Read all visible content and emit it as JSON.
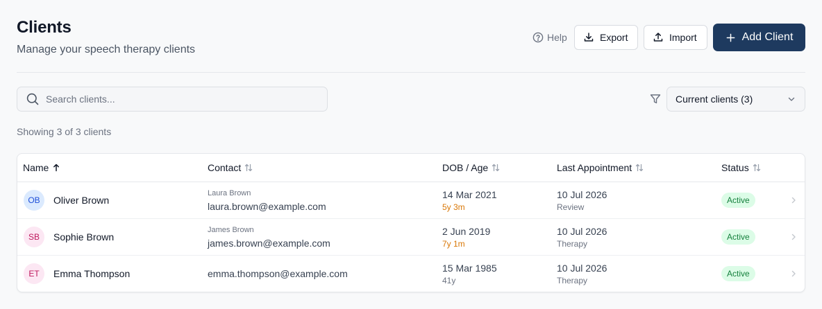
{
  "header": {
    "title": "Clients",
    "subtitle": "Manage your speech therapy clients",
    "help_label": "Help",
    "export_label": "Export",
    "import_label": "Import",
    "add_label": "Add Client"
  },
  "search": {
    "placeholder": "Search clients..."
  },
  "filter": {
    "selected": "Current clients (3)"
  },
  "summary": "Showing 3 of 3 clients",
  "table": {
    "columns": {
      "name": "Name",
      "contact": "Contact",
      "dob": "DOB / Age",
      "last_appointment": "Last Appointment",
      "status": "Status"
    },
    "rows": [
      {
        "initials": "OB",
        "name": "Oliver Brown",
        "contact_name": "Laura Brown",
        "contact_email": "laura.brown@example.com",
        "dob": "14 Mar 2021",
        "age": "5y 3m",
        "appt_date": "10 Jul 2026",
        "appt_type": "Review",
        "status": "Active"
      },
      {
        "initials": "SB",
        "name": "Sophie Brown",
        "contact_name": "James Brown",
        "contact_email": "james.brown@example.com",
        "dob": "2 Jun 2019",
        "age": "7y 1m",
        "appt_date": "10 Jul 2026",
        "appt_type": "Therapy",
        "status": "Active"
      },
      {
        "initials": "ET",
        "name": "Emma Thompson",
        "contact_name": "",
        "contact_email": "emma.thompson@example.com",
        "dob": "15 Mar 1985",
        "age": "41y",
        "appt_date": "10 Jul 2026",
        "appt_type": "Therapy",
        "status": "Active"
      }
    ]
  },
  "colors": {
    "primary": "#1e3a5f",
    "child_age": "#d97706",
    "adult_age": "#6b7280",
    "status_bg": "#dcfce7",
    "status_text": "#15803d",
    "avatar_ob_bg": "#dbeafe",
    "avatar_ob_text": "#1d4ed8",
    "avatar_sb_bg": "#fce7f3",
    "avatar_sb_text": "#be185d",
    "avatar_et_bg": "#fce7f3",
    "avatar_et_text": "#be185d"
  },
  "icons": {
    "help": "help-circle-icon",
    "export": "download-icon",
    "import": "upload-icon",
    "add": "plus-icon",
    "search": "search-icon",
    "filter": "filter-icon",
    "select": "chevron-down-icon",
    "sort_active": "arrow-up-icon",
    "sort": "sort-icon",
    "row_action": "chevron-right-icon"
  }
}
